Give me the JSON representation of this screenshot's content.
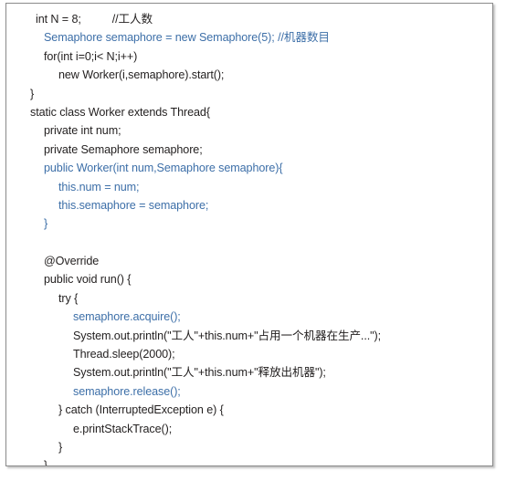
{
  "figure": {
    "kind": "code-listing",
    "language": "Java",
    "border_color": "#8a8a8a",
    "background_color": "#ffffff"
  },
  "colors": {
    "default_text": "#221f1f",
    "highlight_text": "#3d6fa8"
  },
  "code": {
    "lines": [
      {
        "indent": "i1",
        "color": "default",
        "text": "int N = 8;          //工人数"
      },
      {
        "indent": "i2",
        "color": "blue",
        "text": "Semaphore semaphore = new Semaphore(5); //机器数目"
      },
      {
        "indent": "i2",
        "color": "default",
        "text": "for(int i=0;i< N;i++)"
      },
      {
        "indent": "i3",
        "color": "default",
        "text": "new Worker(i,semaphore).start();"
      },
      {
        "indent": "i0",
        "color": "default",
        "text": "}"
      },
      {
        "indent": "i0",
        "color": "default",
        "text": "static class Worker extends Thread{"
      },
      {
        "indent": "i2",
        "color": "default",
        "text": "private int num;"
      },
      {
        "indent": "i2",
        "color": "default",
        "text": "private Semaphore semaphore;"
      },
      {
        "indent": "i2",
        "color": "blue",
        "text": "public Worker(int num,Semaphore semaphore){"
      },
      {
        "indent": "i3",
        "color": "blue",
        "text": "this.num = num;"
      },
      {
        "indent": "i3",
        "color": "blue",
        "text": "this.semaphore = semaphore;"
      },
      {
        "indent": "i2",
        "color": "blue",
        "text": "}"
      },
      {
        "indent": "i0",
        "color": "default",
        "text": ""
      },
      {
        "indent": "i2",
        "color": "default",
        "text": "@Override"
      },
      {
        "indent": "i2",
        "color": "default",
        "text": "public void run() {"
      },
      {
        "indent": "i3",
        "color": "default",
        "text": "try {"
      },
      {
        "indent": "i4",
        "color": "blue",
        "text": "semaphore.acquire();"
      },
      {
        "indent": "i4",
        "color": "default",
        "text": "System.out.println(\"工人\"+this.num+\"占用一个机器在生产...\");"
      },
      {
        "indent": "i4",
        "color": "default",
        "text": "Thread.sleep(2000);"
      },
      {
        "indent": "i4",
        "color": "default",
        "text": "System.out.println(\"工人\"+this.num+\"释放出机器\");"
      },
      {
        "indent": "i4",
        "color": "blue",
        "text": "semaphore.release();"
      },
      {
        "indent": "i3",
        "color": "default",
        "text": "} catch (InterruptedException e) {"
      },
      {
        "indent": "i4",
        "color": "default",
        "text": "e.printStackTrace();"
      },
      {
        "indent": "i3",
        "color": "default",
        "text": "}"
      },
      {
        "indent": "i2",
        "color": "default",
        "text": "}"
      }
    ]
  }
}
